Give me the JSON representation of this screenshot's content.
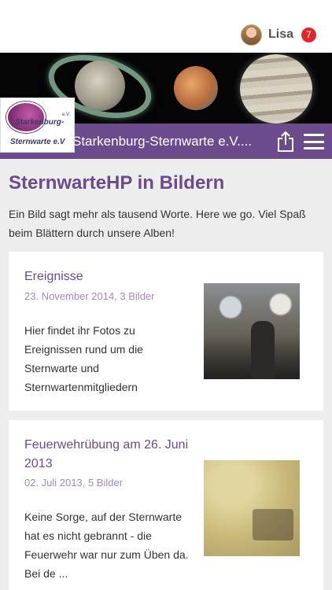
{
  "user": {
    "name": "Lisa",
    "notifications": "7"
  },
  "header": {
    "site_title": "Starkenburg-Sternwarte e.V....",
    "logo_text_1": "Starkenburg-",
    "logo_text_2": "Sternwarte e.V",
    "logo_ev": "e.V."
  },
  "page": {
    "title": "SternwarteHP in Bildern",
    "intro": "Ein Bild sagt mehr als tausend Worte. Here we go. Viel Spaß beim Blättern durch unsere Alben!"
  },
  "albums": [
    {
      "title": "Ereignisse",
      "meta": "23. November 2014, 3 Bilder",
      "description": "Hier findet ihr Fotos zu Ereignissen rund um die Sternwarte und Sternwartenmitgliedern"
    },
    {
      "title": "Feuerwehrübung am 26. Juni 2013",
      "meta": "02. Juli 2013, 5 Bilder",
      "description": "Keine Sorge, auf der Sternwarte hat es nicht gebrannt - die Feuerwehr war nur zum Üben da. Bei de ..."
    }
  ],
  "colors": {
    "brand": "#6c4b8d",
    "badge": "#e0252b",
    "meta": "#a18ab8"
  },
  "icons": {
    "share": "share-icon",
    "menu": "menu-icon"
  }
}
